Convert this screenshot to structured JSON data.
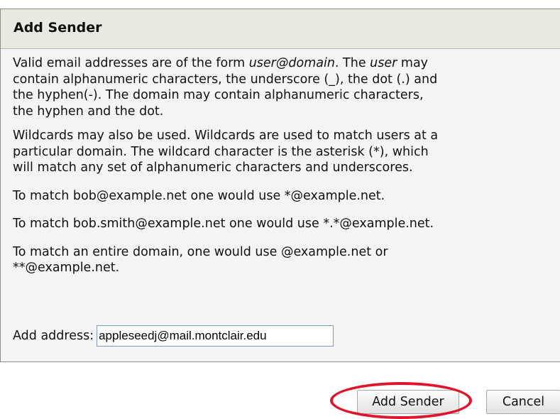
{
  "dialog": {
    "title": "Add Sender",
    "intro": {
      "pre": "Valid email addresses are of the form ",
      "user_domain": "user@domain",
      "mid": ". The ",
      "user": "user",
      "post": " may",
      "line2": "contain alphanumeric characters, the underscore (_), the dot (.) and",
      "line3": "the hyphen(-). The domain may contain alphanumeric characters,",
      "line4": "the hyphen and the dot."
    },
    "wildcards": {
      "line1": "Wildcards may also be used. Wildcards are used to match users at a",
      "line2": "particular domain. The wildcard character is the asterisk (*), which",
      "line3": "will match any set of alphanumeric characters and underscores."
    },
    "example1": "To match bob@example.net one would use *@example.net.",
    "example2": "To match bob.smith@example.net one would use *.*@example.net.",
    "example3": {
      "line1": "To match an entire domain, one would use @example.net or",
      "line2": "**@example.net."
    },
    "add_address": {
      "label": "Add address:",
      "value": "appleseedj@mail.montclair.edu"
    }
  },
  "buttons": {
    "add_sender": "Add Sender",
    "cancel": "Cancel"
  },
  "colors": {
    "highlight": "#e0142a",
    "titlebar": "#e9e9e1",
    "panel": "#f4f4f4"
  }
}
